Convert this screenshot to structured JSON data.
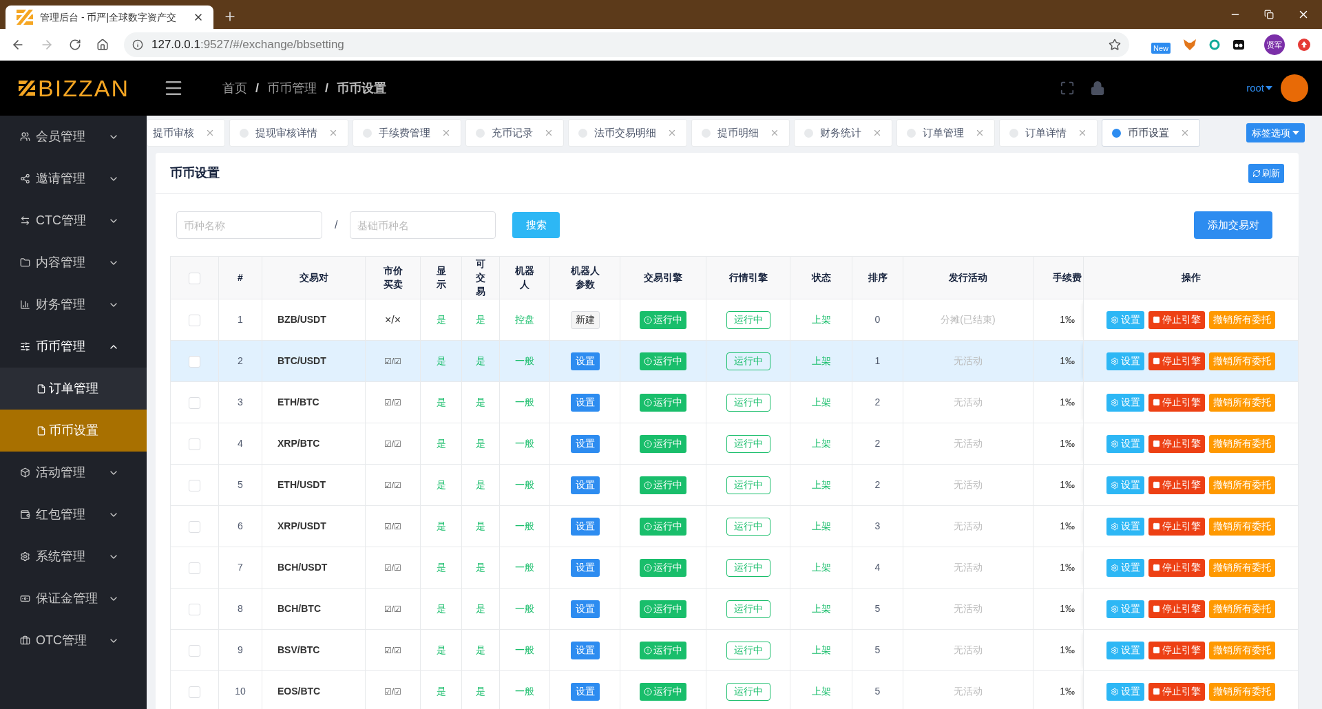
{
  "browser": {
    "tab_title": "管理后台 - 币严|全球数字资产交",
    "url_host": "127.0.0.1",
    "url_rest": ":9527/#/exchange/bbsetting",
    "ext_badge": "New",
    "profile": "贤军"
  },
  "header": {
    "logo": "BIZZAN",
    "breadcrumb": [
      "首页",
      "币币管理",
      "币币设置"
    ],
    "breadcrumb_separator": "/",
    "user": "root"
  },
  "sidebar": {
    "items": [
      {
        "label": "会员管理",
        "expanded": false
      },
      {
        "label": "邀请管理",
        "expanded": false
      },
      {
        "label": "CTC管理",
        "expanded": false
      },
      {
        "label": "内容管理",
        "expanded": false
      },
      {
        "label": "财务管理",
        "expanded": false
      },
      {
        "label": "币币管理",
        "expanded": true,
        "children": [
          {
            "label": "订单管理",
            "selected": false
          },
          {
            "label": "币币设置",
            "selected": true
          }
        ]
      },
      {
        "label": "活动管理",
        "expanded": false
      },
      {
        "label": "红包管理",
        "expanded": false
      },
      {
        "label": "系统管理",
        "expanded": false
      },
      {
        "label": "保证金管理",
        "expanded": false
      },
      {
        "label": "OTC管理",
        "expanded": false
      }
    ]
  },
  "tags": {
    "items": [
      {
        "label": "提币审核",
        "selected": false
      },
      {
        "label": "提现审核详情",
        "selected": false
      },
      {
        "label": "手续费管理",
        "selected": false
      },
      {
        "label": "充币记录",
        "selected": false
      },
      {
        "label": "法币交易明细",
        "selected": false
      },
      {
        "label": "提币明细",
        "selected": false
      },
      {
        "label": "财务统计",
        "selected": false
      },
      {
        "label": "订单管理",
        "selected": false
      },
      {
        "label": "订单详情",
        "selected": false
      },
      {
        "label": "币币设置",
        "selected": true
      }
    ],
    "options_button": "标签选项"
  },
  "card": {
    "title": "币币设置",
    "refresh": "刷新",
    "search": {
      "coin_placeholder": "币种名称",
      "separator": "/",
      "base_placeholder": "基础币种名",
      "button": "搜索"
    },
    "add_button": "添加交易对"
  },
  "table": {
    "select_all": {
      "checked": false
    },
    "columns": [
      "#",
      "交易对",
      "市价买卖",
      "显示",
      "可交易",
      "机器人",
      "机器人参数",
      "交易引擎",
      "行情引擎",
      "状态",
      "排序",
      "发行活动",
      "手续费",
      "操作"
    ],
    "rows": [
      {
        "selected": false,
        "checked": false,
        "num": "1",
        "pair": "BZB/USDT",
        "market": "×/×",
        "show": "是",
        "tradable": "是",
        "robot": "控盘",
        "robot_param": {
          "label": "新建",
          "kind": "new"
        },
        "engine": "运行中",
        "market_engine": "运行中",
        "status": "上架",
        "sort": "0",
        "activity": "分摊(已结束)",
        "fee": "1‰",
        "actions": [
          "设置",
          "停止引擎",
          "撤销所有委托"
        ]
      },
      {
        "selected": true,
        "checked": false,
        "num": "2",
        "pair": "BTC/USDT",
        "market": "☑/☑",
        "show": "是",
        "tradable": "是",
        "robot": "一般",
        "robot_param": {
          "label": "设置",
          "kind": "edit"
        },
        "engine": "运行中",
        "market_engine": "运行中",
        "status": "上架",
        "sort": "1",
        "activity": "无活动",
        "fee": "1‰",
        "actions": [
          "设置",
          "停止引擎",
          "撤销所有委托"
        ]
      },
      {
        "selected": false,
        "checked": false,
        "num": "3",
        "pair": "ETH/BTC",
        "market": "☑/☑",
        "show": "是",
        "tradable": "是",
        "robot": "一般",
        "robot_param": {
          "label": "设置",
          "kind": "edit"
        },
        "engine": "运行中",
        "market_engine": "运行中",
        "status": "上架",
        "sort": "2",
        "activity": "无活动",
        "fee": "1‰",
        "actions": [
          "设置",
          "停止引擎",
          "撤销所有委托"
        ]
      },
      {
        "selected": false,
        "checked": false,
        "num": "4",
        "pair": "XRP/BTC",
        "market": "☑/☑",
        "show": "是",
        "tradable": "是",
        "robot": "一般",
        "robot_param": {
          "label": "设置",
          "kind": "edit"
        },
        "engine": "运行中",
        "market_engine": "运行中",
        "status": "上架",
        "sort": "2",
        "activity": "无活动",
        "fee": "1‰",
        "actions": [
          "设置",
          "停止引擎",
          "撤销所有委托"
        ]
      },
      {
        "selected": false,
        "checked": false,
        "num": "5",
        "pair": "ETH/USDT",
        "market": "☑/☑",
        "show": "是",
        "tradable": "是",
        "robot": "一般",
        "robot_param": {
          "label": "设置",
          "kind": "edit"
        },
        "engine": "运行中",
        "market_engine": "运行中",
        "status": "上架",
        "sort": "2",
        "activity": "无活动",
        "fee": "1‰",
        "actions": [
          "设置",
          "停止引擎",
          "撤销所有委托"
        ]
      },
      {
        "selected": false,
        "checked": false,
        "num": "6",
        "pair": "XRP/USDT",
        "market": "☑/☑",
        "show": "是",
        "tradable": "是",
        "robot": "一般",
        "robot_param": {
          "label": "设置",
          "kind": "edit"
        },
        "engine": "运行中",
        "market_engine": "运行中",
        "status": "上架",
        "sort": "3",
        "activity": "无活动",
        "fee": "1‰",
        "actions": [
          "设置",
          "停止引擎",
          "撤销所有委托"
        ]
      },
      {
        "selected": false,
        "checked": false,
        "num": "7",
        "pair": "BCH/USDT",
        "market": "☑/☑",
        "show": "是",
        "tradable": "是",
        "robot": "一般",
        "robot_param": {
          "label": "设置",
          "kind": "edit"
        },
        "engine": "运行中",
        "market_engine": "运行中",
        "status": "上架",
        "sort": "4",
        "activity": "无活动",
        "fee": "1‰",
        "actions": [
          "设置",
          "停止引擎",
          "撤销所有委托"
        ]
      },
      {
        "selected": false,
        "checked": false,
        "num": "8",
        "pair": "BCH/BTC",
        "market": "☑/☑",
        "show": "是",
        "tradable": "是",
        "robot": "一般",
        "robot_param": {
          "label": "设置",
          "kind": "edit"
        },
        "engine": "运行中",
        "market_engine": "运行中",
        "status": "上架",
        "sort": "5",
        "activity": "无活动",
        "fee": "1‰",
        "actions": [
          "设置",
          "停止引擎",
          "撤销所有委托"
        ]
      },
      {
        "selected": false,
        "checked": false,
        "num": "9",
        "pair": "BSV/BTC",
        "market": "☑/☑",
        "show": "是",
        "tradable": "是",
        "robot": "一般",
        "robot_param": {
          "label": "设置",
          "kind": "edit"
        },
        "engine": "运行中",
        "market_engine": "运行中",
        "status": "上架",
        "sort": "5",
        "activity": "无活动",
        "fee": "1‰",
        "actions": [
          "设置",
          "停止引擎",
          "撤销所有委托"
        ]
      },
      {
        "selected": false,
        "checked": false,
        "num": "10",
        "pair": "EOS/BTC",
        "market": "☑/☑",
        "show": "是",
        "tradable": "是",
        "robot": "一般",
        "robot_param": {
          "label": "设置",
          "kind": "edit"
        },
        "engine": "运行中",
        "market_engine": "运行中",
        "status": "上架",
        "sort": "5",
        "activity": "无活动",
        "fee": "1‰",
        "actions": [
          "设置",
          "停止引擎",
          "撤销所有委托"
        ]
      }
    ]
  }
}
